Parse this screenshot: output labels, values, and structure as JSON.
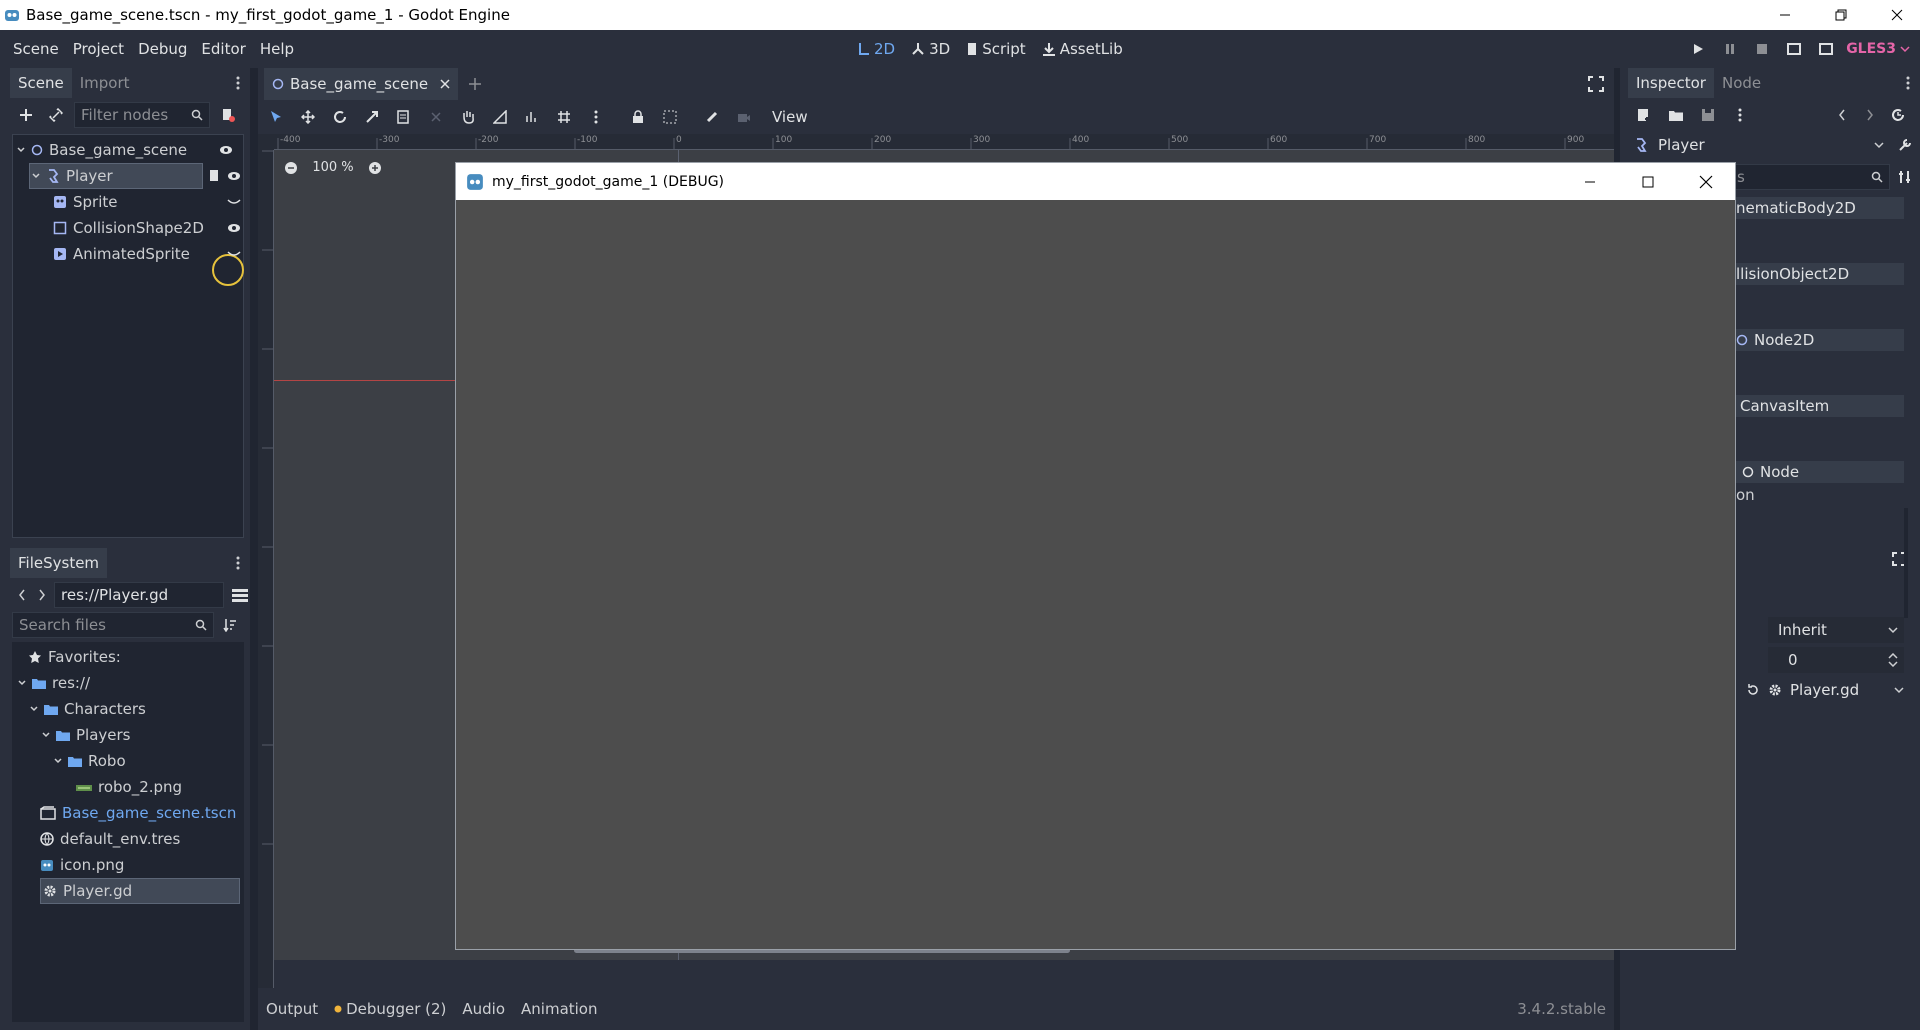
{
  "window": {
    "title": "Base_game_scene.tscn - my_first_godot_game_1 - Godot Engine"
  },
  "menubar": {
    "menus": [
      "Scene",
      "Project",
      "Debug",
      "Editor",
      "Help"
    ],
    "workspaces": [
      "2D",
      "3D",
      "Script",
      "AssetLib"
    ],
    "active_workspace": "2D",
    "renderer": "GLES3"
  },
  "scene_dock": {
    "tabs": [
      "Scene",
      "Import"
    ],
    "filter_placeholder": "Filter nodes",
    "nodes": [
      {
        "label": "Base_game_scene",
        "icon": "node2d-circle-icon"
      },
      {
        "label": "Player",
        "icon": "kinematic-body-icon",
        "selected": true
      },
      {
        "label": "Sprite",
        "icon": "sprite-icon"
      },
      {
        "label": "CollisionShape2D",
        "icon": "collision-shape-icon"
      },
      {
        "label": "AnimatedSprite",
        "icon": "animated-sprite-icon"
      }
    ]
  },
  "filesystem_dock": {
    "title": "FileSystem",
    "path": "res://Player.gd",
    "search_placeholder": "Search files",
    "items": [
      {
        "label": "Favorites:",
        "icon": "star-icon"
      },
      {
        "label": "res://",
        "icon": "folder-icon"
      },
      {
        "label": "Characters",
        "icon": "folder-icon"
      },
      {
        "label": "Players",
        "icon": "folder-icon"
      },
      {
        "label": "Robo",
        "icon": "folder-icon"
      },
      {
        "label": "robo_2.png",
        "icon": "image-icon"
      },
      {
        "label": "Base_game_scene.tscn",
        "icon": "scene-file-icon"
      },
      {
        "label": "default_env.tres",
        "icon": "globe-icon"
      },
      {
        "label": "icon.png",
        "icon": "image-icon"
      },
      {
        "label": "Player.gd",
        "icon": "gear-icon",
        "selected": true
      }
    ]
  },
  "editor": {
    "scene_tab": "Base_game_scene",
    "view_label": "View",
    "zoom": "100 %",
    "ruler_marks": [
      "-400",
      "-300",
      "-200",
      "-100",
      "0",
      "100",
      "200",
      "300",
      "400",
      "500",
      "600",
      "700",
      "800",
      "900"
    ],
    "vruler_marks": [
      "-200",
      "-100",
      "0",
      "100",
      "200",
      "300",
      "400",
      "500"
    ]
  },
  "debug_window": {
    "title": "my_first_godot_game_1 (DEBUG)"
  },
  "bottom_panel": {
    "tabs": [
      "Output",
      "Debugger (2)",
      "Audio",
      "Animation"
    ],
    "version": "3.4.2.stable",
    "debugger_dot_color": "#f0b43c"
  },
  "inspector": {
    "tabs": [
      "Inspector",
      "Node"
    ],
    "object_name": "Player",
    "filter_value": "s",
    "categories": [
      "nematicBody2D",
      "llisionObject2D",
      "Node2D",
      "CanvasItem",
      "Node"
    ],
    "partial_label": "on",
    "pause_mode": "Inherit",
    "number_value": "0",
    "script": "Player.gd"
  },
  "colors": {
    "accent": "#6fa8f0",
    "renderer": "#e565a8",
    "highlight_ring": "#e6c23c"
  }
}
